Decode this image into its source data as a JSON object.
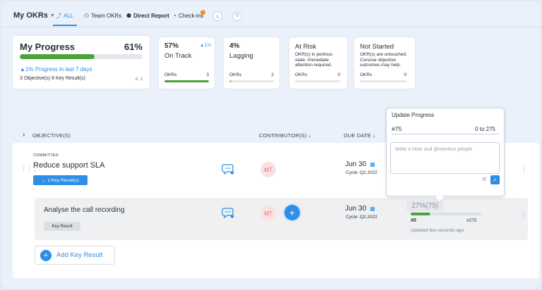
{
  "nav": {
    "title": "My OKRs",
    "tabs": [
      {
        "label": "ALL",
        "icon": "trend-icon"
      },
      {
        "label": "Team OKRs",
        "icon": "team-icon"
      },
      {
        "label": "Direct Report",
        "icon": "org-icon"
      },
      {
        "label": "Check-ins",
        "icon": "check-in-icon"
      }
    ],
    "checkin_badge": "!"
  },
  "my_progress": {
    "title": "My Progress",
    "percent": "61%",
    "progress_fraction": 0.61,
    "delta": "1% Progress in last 7 days",
    "summary": "3 Objective(s) 8 Key Result(s)",
    "contributors": "1"
  },
  "cards": [
    {
      "pct": "57%",
      "delta": "1%",
      "label": "On Track",
      "desc": "",
      "okrs_label": "OKRs",
      "okrs_count": "3",
      "fill": 1.0,
      "color": "#4aa33a"
    },
    {
      "pct": "4%",
      "delta": "",
      "label": "Lagging",
      "desc": "",
      "okrs_label": "OKRs",
      "okrs_count": "2",
      "fill": 0.05,
      "color": "#f2a950"
    },
    {
      "pct": "",
      "delta": "",
      "label": "At Risk",
      "desc": "OKR(s) in perilous state. Immediate attention required.",
      "okrs_label": "OKRs",
      "okrs_count": "0",
      "fill": 0,
      "color": "#e05050"
    },
    {
      "pct": "",
      "delta": "",
      "label": "Not Started",
      "desc": "OKR(s) are untouched. Concise objective outcomes may help.",
      "okrs_label": "OKRs",
      "okrs_count": "0",
      "fill": 0,
      "color": "#9aa1ad"
    }
  ],
  "table": {
    "col_objectives": "OBJECTIVE(S)",
    "col_contributors": "CONTRIBUTOR(S) ↓",
    "col_due": "DUE DATE ↓"
  },
  "objective": {
    "status": "COMMITTED",
    "title": "Reduce support SLA",
    "kr_toggle": "1 Key Result(s)",
    "contributor": "MT",
    "due": "Jun 30",
    "cycle": "Cycle: Q2,2022"
  },
  "key_result": {
    "title": "Analyse the call recording",
    "tag": "Key Result",
    "contributor": "MT",
    "due": "Jun 30",
    "cycle": "Cycle: Q2,2022",
    "progress_text": "27%(75)",
    "progress_fraction": 0.27,
    "min": "#0",
    "max": "#275",
    "updated": "Updated few seconds ago"
  },
  "add_kr": "Add Key Result",
  "popover": {
    "title": "Update Progress",
    "value": "#75",
    "range": "0 to 275",
    "note_placeholder": "Write a Note and @mention people"
  }
}
